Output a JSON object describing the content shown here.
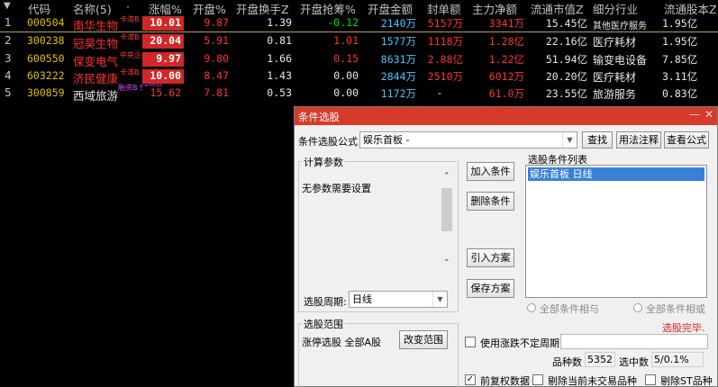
{
  "table": {
    "headers": {
      "code": "代码",
      "name": "名称(5)",
      "dot": "·",
      "change": "涨幅%",
      "open": "开盘%",
      "open_turnover": "开盘换手Z",
      "open_grab": "开盘抢筹%",
      "open_amount": "开盘金额",
      "seal_amount": "封单额",
      "main_net": "主力净额",
      "float_cap": "流通市值Z",
      "industry": "细分行业",
      "float_shares": "流通股本Z"
    },
    "rows": [
      {
        "idx": "1",
        "code": "000504",
        "name": "南华生物",
        "tag": "卡滞B",
        "change": "10.01",
        "open": "9.87",
        "open_turnover": "1.39",
        "open_grab": "-0.12",
        "open_amount": "2140万",
        "seal_amount": "5157万",
        "main_net": "3341万",
        "float_cap": "15.45亿",
        "industry": "其他医疗服务",
        "float_shares": "1.95亿"
      },
      {
        "idx": "2",
        "code": "300238",
        "name": "冠昊生物",
        "tag": "卡滞B",
        "change": "20.04",
        "open": "5.91",
        "open_turnover": "0.81",
        "open_grab": "1.01",
        "open_amount": "1577万",
        "seal_amount": "1118万",
        "main_net": "1.28亿",
        "float_cap": "22.16亿",
        "industry": "医疗耗材",
        "float_shares": "1.95亿"
      },
      {
        "idx": "3",
        "code": "600550",
        "name": "保变电气",
        "tag": "中央企业",
        "change": "9.97",
        "open": "9.80",
        "open_turnover": "1.66",
        "open_grab": "0.15",
        "open_amount": "8631万",
        "seal_amount": "2.88亿",
        "main_net": "1.22亿",
        "float_cap": "51.94亿",
        "industry": "输变电设备",
        "float_shares": "7.85亿"
      },
      {
        "idx": "4",
        "code": "603222",
        "name": "济民健康",
        "tag": "卡滞B",
        "change": "10.00",
        "open": "8.47",
        "open_turnover": "1.43",
        "open_grab": "0.00",
        "open_amount": "2844万",
        "seal_amount": "2510万",
        "main_net": "6012万",
        "float_cap": "20.20亿",
        "industry": "医疗耗材",
        "float_shares": "3.11亿"
      },
      {
        "idx": "5",
        "code": "300859",
        "name": "西域旅游",
        "tag": "融资B ST风险",
        "change": "15.62",
        "open": "7.81",
        "open_turnover": "0.53",
        "open_grab": "0.00",
        "open_amount": "1172万",
        "seal_amount": "-",
        "main_net": "61.0万",
        "float_cap": "23.55亿",
        "industry": "旅游服务",
        "float_shares": "0.83亿"
      }
    ]
  },
  "dialog": {
    "title": "条件选股",
    "window_controls": {
      "minimize": "—",
      "close": "✕"
    },
    "formula_label": "条件选股公式",
    "formula_value": "娱乐首板  -",
    "btn_find": "查找",
    "btn_usage": "用法注释",
    "btn_view": "查看公式",
    "params_group": "计算参数",
    "params_text": "无参数需要设置",
    "period_label": "选股周期:",
    "period_value": "日线",
    "btn_add": "加入条件",
    "btn_delete": "删除条件",
    "btn_import": "引入方案",
    "btn_save": "保存方案",
    "cond_list_label": "选股条件列表",
    "cond_items": [
      "娱乐首板  日线"
    ],
    "radio_and": "全部条件相与",
    "radio_or": "全部条件相或",
    "status_done": "选股完毕.",
    "range_group": "选股范围",
    "range_text": "涨停选股 全部A股",
    "btn_change_range": "改变范围",
    "chk_irregular": "使用涨跌不定周期",
    "count_label": "品种数",
    "count_value": "5352",
    "hit_label": "选中数",
    "hit_value": "5/0.1%",
    "chk_adjusted": "前复权数据",
    "chk_remove_untraded": "剔除当前未交易品种",
    "chk_remove_st": "剔除ST品种"
  },
  "colors": {
    "title_bar": "#d63a2a",
    "up_red": "#ff3232",
    "down_green": "#00e000",
    "code_yellow": "#e0c000",
    "amount_cyan": "#40c8ff"
  }
}
